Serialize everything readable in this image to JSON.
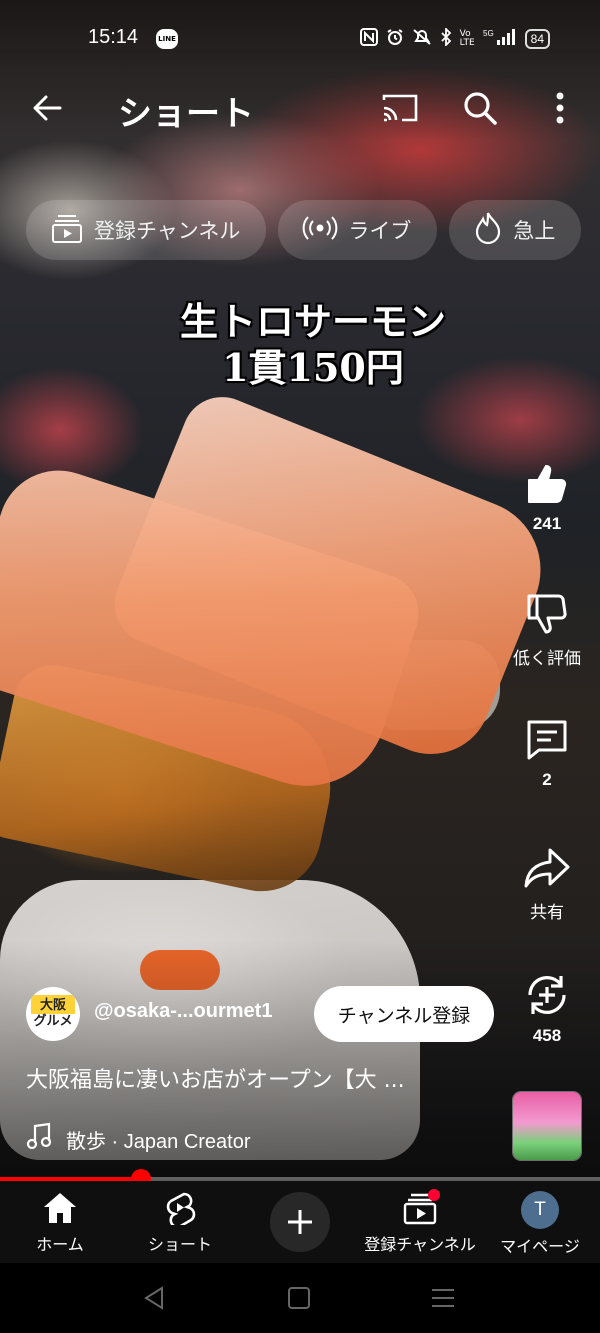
{
  "status_bar": {
    "time": "15:14",
    "line_badge": "LINE",
    "battery": "84"
  },
  "app_bar": {
    "title": "ショート"
  },
  "chips": [
    {
      "label": "登録チャンネル",
      "icon": "subscriptions-icon"
    },
    {
      "label": "ライブ",
      "icon": "live-icon"
    },
    {
      "label": "急上",
      "icon": "trending-icon"
    }
  ],
  "overlay_caption": {
    "line1": "生トロサーモン",
    "line2": "1貫150円"
  },
  "actions": {
    "like_count": "241",
    "dislike_label": "低く評価",
    "comment_count": "2",
    "share_label": "共有",
    "remix_count": "458"
  },
  "channel": {
    "avatar_text_top": "大阪",
    "avatar_text_bottom": "グルメ",
    "handle": "@osaka-...ourmet1",
    "subscribe_label": "チャンネル登録"
  },
  "video": {
    "title": "大阪福島に凄いお店がオープン【大 ...",
    "music": "散歩 · Japan Creator",
    "progress": 0.235
  },
  "bottom_nav": {
    "home": "ホーム",
    "shorts": "ショート",
    "subscriptions": "登録チャンネル",
    "mypage": "マイページ",
    "mypage_avatar_letter": "T"
  },
  "colors": {
    "accent_red": "#ff0000",
    "nav_bg": "#0f0f0f"
  }
}
